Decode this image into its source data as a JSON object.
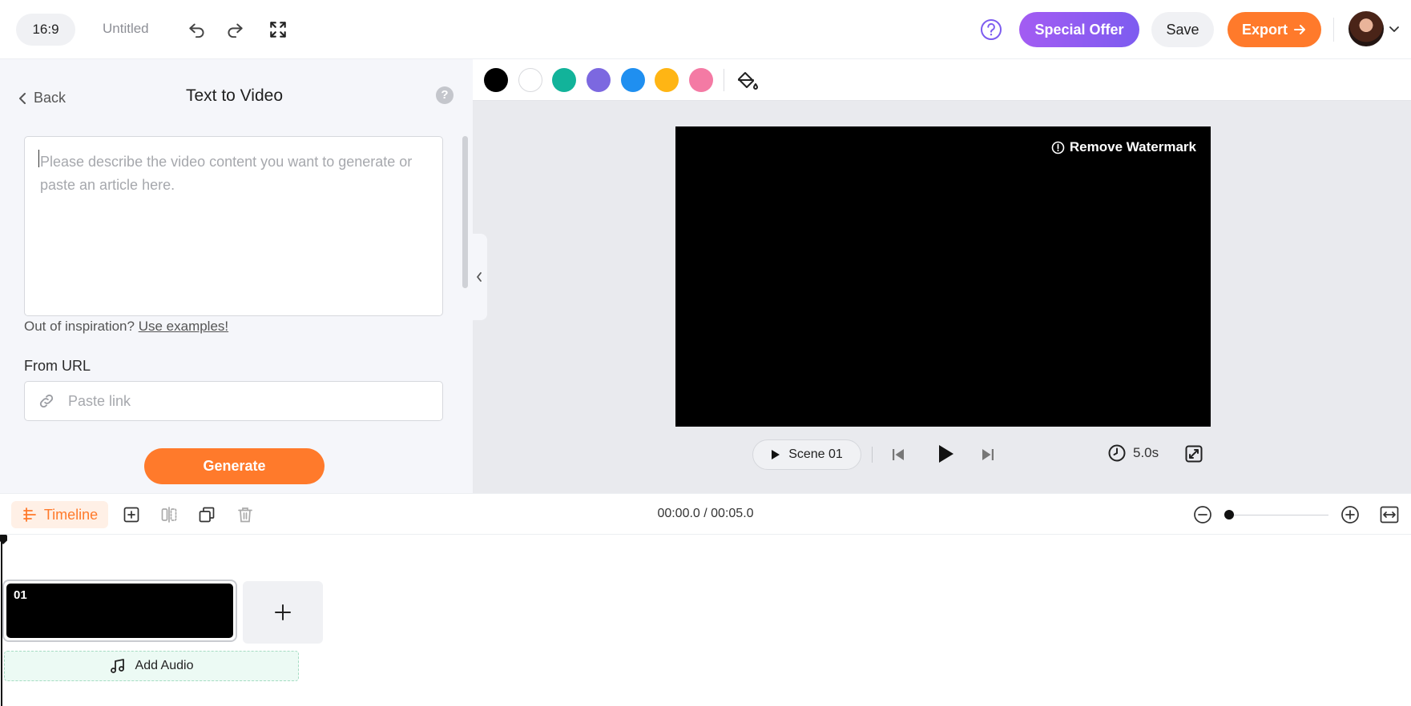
{
  "topbar": {
    "aspect_ratio": "16:9",
    "doc_title": "Untitled",
    "special_offer_label": "Special Offer",
    "save_label": "Save",
    "export_label": "Export"
  },
  "left_panel": {
    "back_label": "Back",
    "title": "Text to Video",
    "prompt_placeholder": "Please describe the video content you want to generate or paste an article here.",
    "prompt_value": "",
    "inspiration_text": "Out of inspiration?",
    "inspiration_link": "Use examples!",
    "url_label": "From URL",
    "url_placeholder": "Paste link",
    "url_value": "",
    "generate_label": "Generate"
  },
  "color_bar": {
    "swatches": [
      "#000000",
      "#ffffff",
      "#12b39a",
      "#7c68e0",
      "#1f8ff0",
      "#ffb514",
      "#f47aa4"
    ]
  },
  "preview": {
    "watermark_label": "Remove Watermark",
    "scene_label": "Scene",
    "scene_number": "01",
    "duration": "5.0s"
  },
  "timeline": {
    "tab_label": "Timeline",
    "timecode": "00:00.0 / 00:05.0",
    "scene_clip_number": "01",
    "add_audio_label": "Add Audio"
  },
  "colors": {
    "accent_orange": "#ff7a2b",
    "accent_purple": "#8a5cf2"
  }
}
